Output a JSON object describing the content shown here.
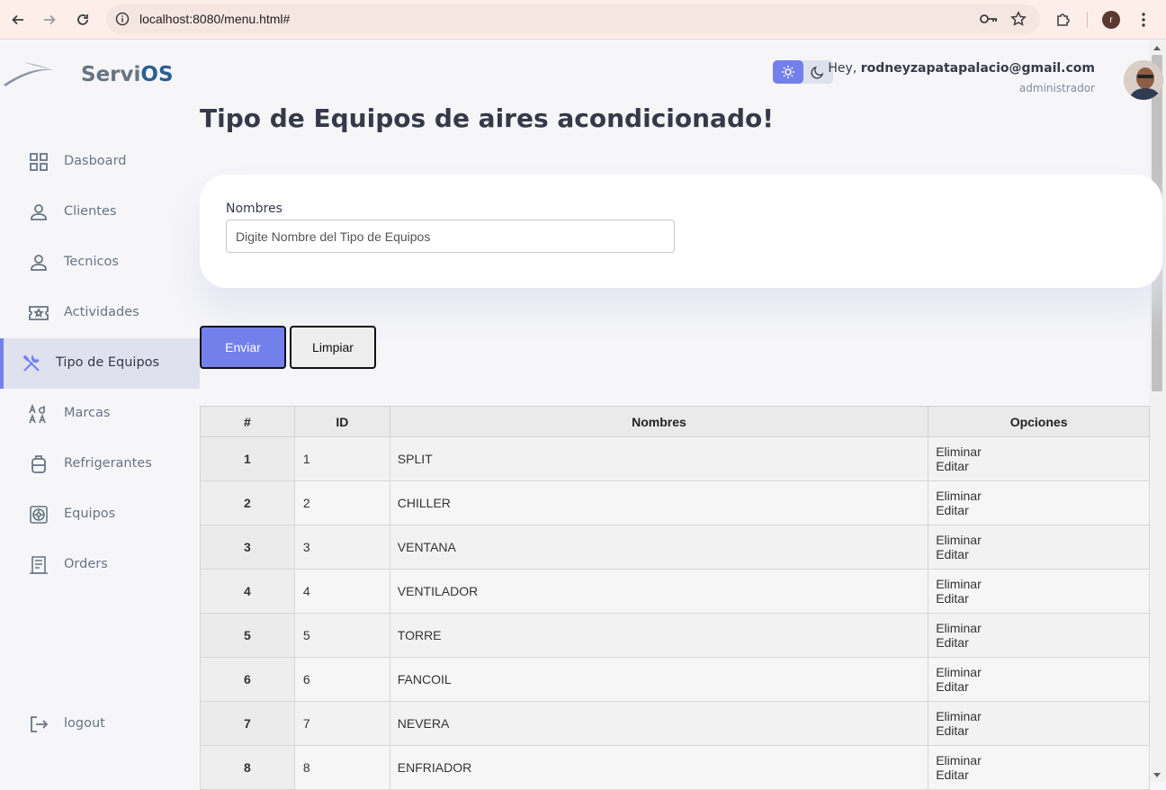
{
  "browser": {
    "url": "localhost:8080/menu.html#",
    "profile_initial": "r"
  },
  "brand": {
    "name_prefix": "Servi",
    "name_suffix": "OS"
  },
  "sidebar": {
    "items": [
      {
        "label": "Dasboard",
        "icon": "grid-icon"
      },
      {
        "label": "Clientes",
        "icon": "person-icon"
      },
      {
        "label": "Tecnicos",
        "icon": "person-icon"
      },
      {
        "label": "Actividades",
        "icon": "ticket-star-icon"
      },
      {
        "label": "Tipo de Equipos",
        "icon": "tools-icon",
        "active": true
      },
      {
        "label": "Marcas",
        "icon": "font-icon"
      },
      {
        "label": "Refrigerantes",
        "icon": "tank-icon"
      },
      {
        "label": "Equipos",
        "icon": "fan-icon"
      },
      {
        "label": "Orders",
        "icon": "receipt-icon"
      }
    ],
    "logout": "logout"
  },
  "header": {
    "greeting": "Hey,",
    "user_email": "rodneyzapatapalacio@gmail.com",
    "role": "administrador"
  },
  "page": {
    "title": "Tipo de Equipos de aires acondicionado!",
    "form": {
      "label": "Nombres",
      "placeholder": "Digite Nombre del Tipo de Equipos",
      "value": ""
    },
    "buttons": {
      "submit": "Enviar",
      "clear": "Limpiar"
    }
  },
  "table": {
    "headers": [
      "#",
      "ID",
      "Nombres",
      "Opciones"
    ],
    "option_delete": "Eliminar",
    "option_edit": "Editar",
    "rows": [
      {
        "n": "1",
        "id": "1",
        "name": "SPLIT"
      },
      {
        "n": "2",
        "id": "2",
        "name": "CHILLER"
      },
      {
        "n": "3",
        "id": "3",
        "name": "VENTANA"
      },
      {
        "n": "4",
        "id": "4",
        "name": "VENTILADOR"
      },
      {
        "n": "5",
        "id": "5",
        "name": "TORRE"
      },
      {
        "n": "6",
        "id": "6",
        "name": "FANCOIL"
      },
      {
        "n": "7",
        "id": "7",
        "name": "NEVERA"
      },
      {
        "n": "8",
        "id": "8",
        "name": "ENFRIADOR"
      }
    ]
  },
  "colors": {
    "primary": "#7380ec",
    "text": "#363949",
    "muted": "#677483",
    "background": "#f6f6f9"
  }
}
